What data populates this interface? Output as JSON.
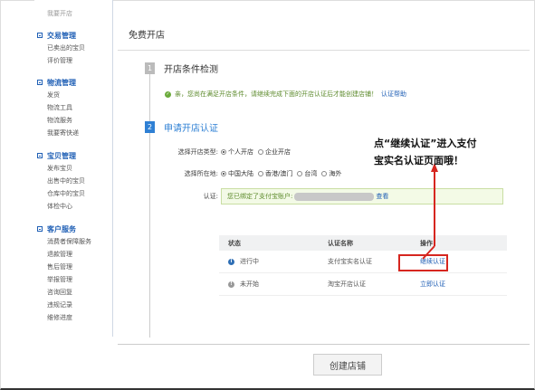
{
  "sidebar": {
    "top_item": "我要开店",
    "groups": [
      {
        "title": "交易管理",
        "items": [
          "已卖出的宝贝",
          "评价管理"
        ]
      },
      {
        "title": "物流管理",
        "items": [
          "发货",
          "物流工具",
          "物流服务",
          "我要寄快递"
        ]
      },
      {
        "title": "宝贝管理",
        "items": [
          "发布宝贝",
          "出售中的宝贝",
          "仓库中的宝贝",
          "体检中心"
        ]
      },
      {
        "title": "客户服务",
        "items": [
          "消费者保障服务",
          "退款管理",
          "售后管理",
          "举报管理",
          "咨询回复",
          "违规记录",
          "维修进度"
        ]
      }
    ]
  },
  "header": {
    "title": "免费开店"
  },
  "step1": {
    "num": "1",
    "label": "开店条件检测"
  },
  "ok_row": {
    "text": "亲，您尚在满足开店条件，请继续完成下面的开店认证后才能创建店铺！",
    "link": "认证帮助"
  },
  "step2": {
    "num": "2",
    "label": "申请开店认证"
  },
  "form": {
    "shop_type": {
      "label": "选择开店类型:",
      "options": [
        "个人开店",
        "企业开店"
      ]
    },
    "location": {
      "label": "选择所在地:",
      "options": [
        "中国大陆",
        "香港/澳门",
        "台湾",
        "海外"
      ]
    },
    "auth": {
      "label": "认证:",
      "notice_prefix": "您已绑定了支付宝账户:",
      "notice_link": "查看"
    }
  },
  "table": {
    "headers": [
      "状态",
      "认证名称",
      "操作"
    ],
    "rows": [
      {
        "status": "进行中",
        "name": "支付宝实名认证",
        "action": "继续认证"
      },
      {
        "status": "未开始",
        "name": "淘宝开店认证",
        "action": "立即认证"
      }
    ]
  },
  "create_button": "创建店铺",
  "annotation": {
    "line1": "点“继续认证”进入支付",
    "line2": "宝实名认证页面哦！"
  },
  "colors": {
    "accent": "#2f80d4",
    "link": "#1f5fb5",
    "highlight": "#d6261f",
    "ok": "#6bab3b"
  }
}
